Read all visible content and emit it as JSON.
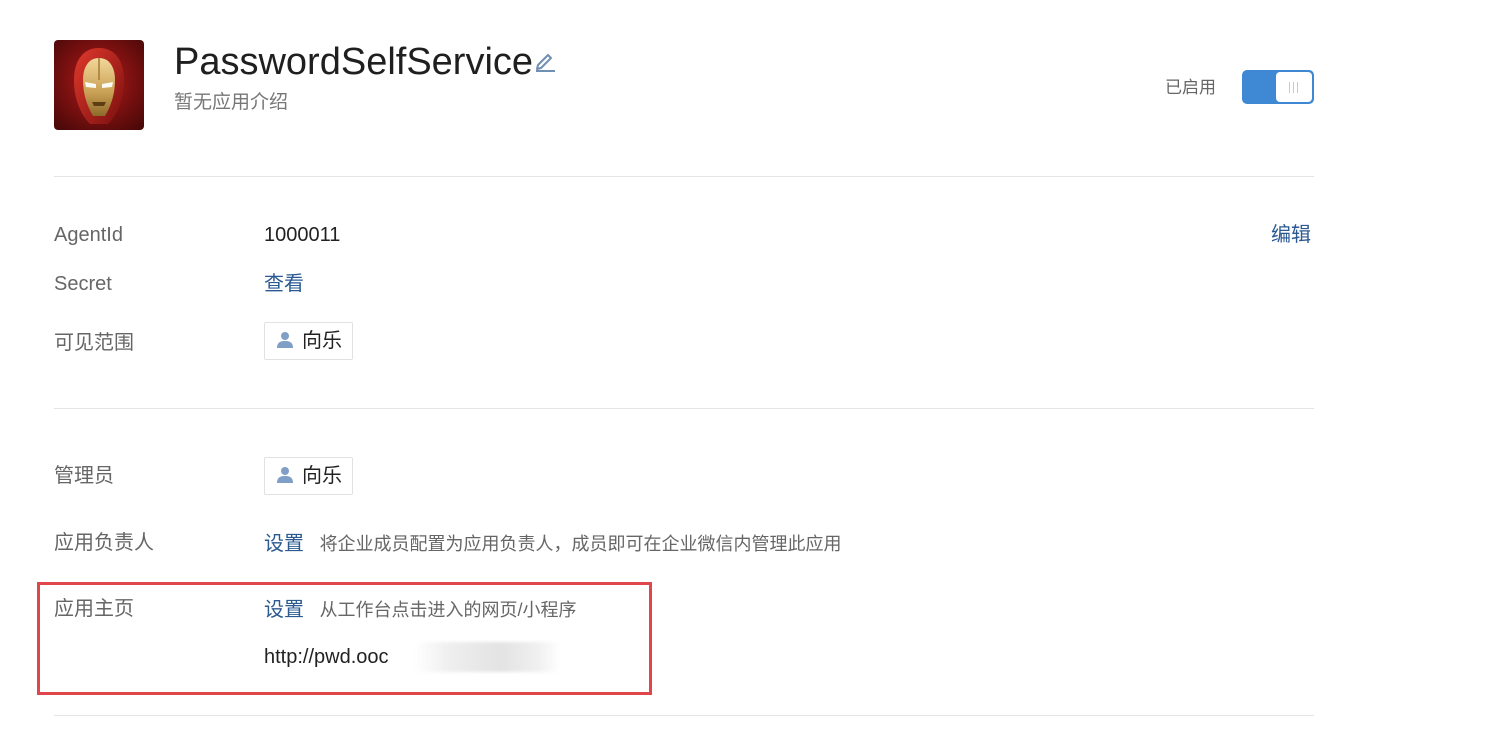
{
  "header": {
    "app_name": "PasswordSelfService",
    "description": "暂无应用介绍",
    "status_label": "已启用",
    "enabled": true
  },
  "info": {
    "agentid_label": "AgentId",
    "agentid_value": "1000011",
    "edit_link": "编辑",
    "secret_label": "Secret",
    "secret_link": "查看",
    "visibility_label": "可见范围",
    "visibility_member": "向乐"
  },
  "admin": {
    "admin_label": "管理员",
    "admin_member": "向乐",
    "owner_label": "应用负责人",
    "owner_link": "设置",
    "owner_hint": "将企业成员配置为应用负责人，成员即可在企业微信内管理此应用",
    "homepage_label": "应用主页",
    "homepage_link": "设置",
    "homepage_hint": "从工作台点击进入的网页/小程序",
    "homepage_url": "http://pwd.ooc"
  },
  "colors": {
    "link": "#2b5a92",
    "toggle_on": "#3e88d4",
    "highlight": "#e0474c"
  }
}
